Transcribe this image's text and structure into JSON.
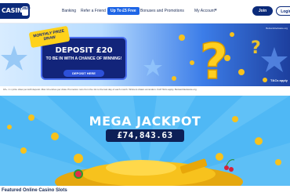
{
  "nav": {
    "logo_text": "CASINO",
    "logo_badge": "2020",
    "links": {
      "banking": "Banking",
      "refer": "Refer a Friend",
      "free": "Up To £5 Free",
      "bonuses": "Bonuses and Promotions",
      "account": "My Account"
    },
    "join_label": "Join",
    "login_label": "Login"
  },
  "promo": {
    "ribbon": "MONTHLY PRIZE DRAW",
    "deposit": "DEPOSIT £20",
    "sub": "TO BE IN WITH A CHANCE OF WINNING!",
    "cta": "DEPOSIT HERE",
    "corner_small": "BeGambleAware.org",
    "corner_big": "T&Cs apply"
  },
  "terms": "18+. 1 x prize draw per £20 deposit. Max 10 entries per draw. Promotion runs from the 1st to the last day of each month. Winners drawn at random. Full T&Cs apply. BeGambleAware.org",
  "jackpot": {
    "title": "MEGA JACKPOT",
    "amount": "£74,843.63"
  },
  "featured_heading": "Featured Online Casino Slots",
  "colors": {
    "brand_navy": "#0b2a7a",
    "accent_blue": "#1f66e6",
    "jackpot_sky": "#4fb8f5",
    "coin_gold": "#f7c21d"
  }
}
